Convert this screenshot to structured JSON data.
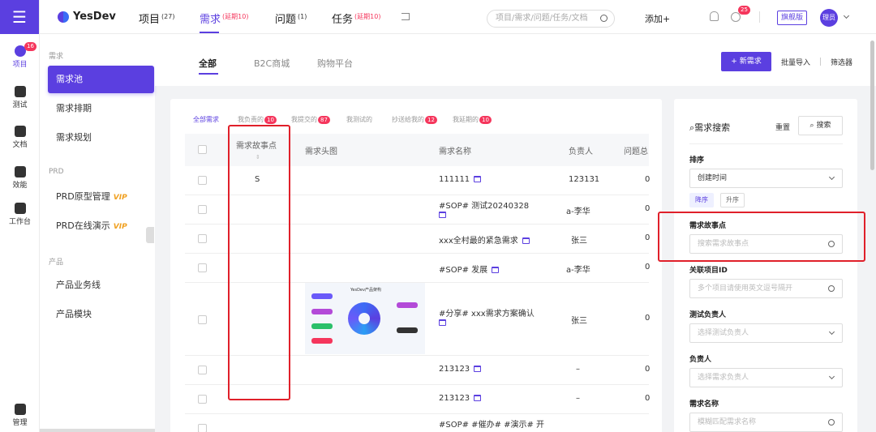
{
  "rail": {
    "menu_icon": "hamburger-icon",
    "items": [
      {
        "label": "项目",
        "badge": "16",
        "icon": "project-icon"
      },
      {
        "label": "测试",
        "icon": "test-icon"
      },
      {
        "label": "文档",
        "icon": "doc-icon"
      },
      {
        "label": "效能",
        "icon": "chart-icon"
      },
      {
        "label": "工作台",
        "icon": "grid-icon"
      },
      {
        "label": "管理",
        "icon": "manage-icon"
      }
    ]
  },
  "header": {
    "logo": "YesDev",
    "nav": [
      {
        "label": "项目",
        "sup": "(27)"
      },
      {
        "label": "需求",
        "sup": "(延期10)"
      },
      {
        "label": "问题",
        "sup": "(1)"
      },
      {
        "label": "任务",
        "sup": "(延期10)"
      }
    ],
    "search_placeholder": "项目/需求/问题/任务/文档",
    "add_label": "添加+",
    "notif_badge": "25",
    "edition": "旗舰版",
    "avatar": "理员"
  },
  "sidebar": {
    "group1": "需求",
    "items1": [
      "需求池",
      "需求排期",
      "需求规划"
    ],
    "group2": "PRD",
    "items2": [
      {
        "label": "PRD原型管理",
        "vip": "VIP"
      },
      {
        "label": "PRD在线演示",
        "vip": "VIP"
      }
    ],
    "group3": "产品",
    "items3": [
      "产品业务线",
      "产品模块"
    ]
  },
  "main": {
    "tabs": [
      "全部",
      "B2C商城",
      "购物平台"
    ],
    "new_button": "+ 新需求",
    "bulk_import": "批量导入",
    "filter": "筛选器"
  },
  "table": {
    "subtabs": [
      {
        "label": "全部需求",
        "count": ""
      },
      {
        "label": "我负责的",
        "count": "10"
      },
      {
        "label": "我提交的",
        "count": "87"
      },
      {
        "label": "我测试的",
        "count": ""
      },
      {
        "label": "抄送给我的",
        "count": "12"
      },
      {
        "label": "我延期的",
        "count": "10"
      }
    ],
    "columns": [
      "需求故事点",
      "需求头图",
      "需求名称",
      "负责人",
      "问题总"
    ],
    "rows": [
      {
        "points": "S",
        "name": "111111",
        "owner": "123131",
        "issues": "0"
      },
      {
        "points": "",
        "name": "#SOP# 测试20240328",
        "owner": "a-李华",
        "issues": "0"
      },
      {
        "points": "",
        "name": "xxx全村最的紧急需求",
        "owner": "张三",
        "issues": "0"
      },
      {
        "points": "",
        "name": "#SOP# 发展",
        "owner": "a-李华",
        "issues": "0"
      },
      {
        "points": "",
        "name": "#分享# xxx需求方案确认",
        "owner": "张三",
        "issues": "0",
        "thumb_title": "YesDev产品架构"
      },
      {
        "points": "",
        "name": "213123",
        "owner": "–",
        "issues": "0"
      },
      {
        "points": "",
        "name": "213123",
        "owner": "–",
        "issues": "0"
      },
      {
        "points": "",
        "name": "#SOP# #催办# #演示# 开",
        "owner": "",
        "issues": ""
      }
    ]
  },
  "filters": {
    "title": "需求搜索",
    "reset": "重置",
    "search": "搜索",
    "sort_label": "排序",
    "sort_value": "创建时间",
    "desc": "降序",
    "asc": "升序",
    "story_label": "需求故事点",
    "story_placeholder": "搜索需求故事点",
    "project_label": "关联项目ID",
    "project_placeholder": "多个项目请使用英文逗号隔开",
    "tester_label": "测试负责人",
    "tester_placeholder": "选择测试负责人",
    "owner_label": "负责人",
    "owner_placeholder": "选择需求负责人",
    "name_label": "需求名称",
    "name_placeholder": "模糊匹配需求名称"
  }
}
